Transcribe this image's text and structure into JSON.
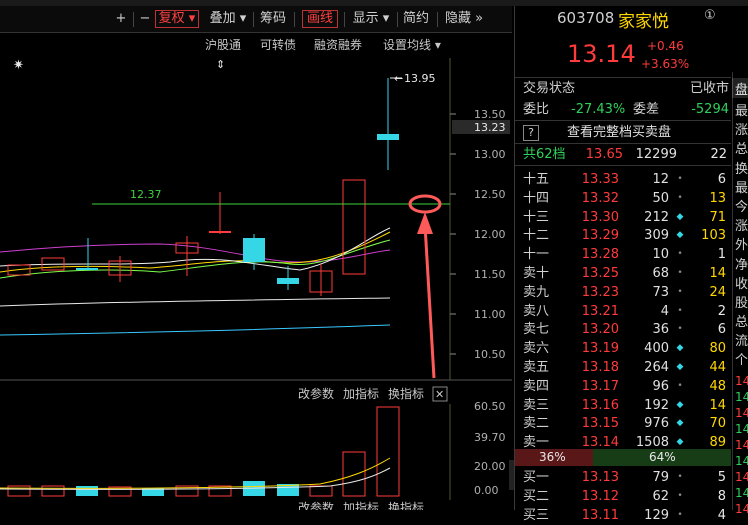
{
  "toolbar": {
    "items": [
      {
        "label": "+",
        "icon": "plus-icon"
      },
      {
        "label": "−",
        "icon": "minus-icon"
      },
      {
        "label": "复权 ▾",
        "selected": true
      },
      {
        "label": "叠加 ▾"
      },
      {
        "label": "筹码"
      },
      {
        "label": "画线",
        "selected": true
      },
      {
        "label": "显示 ▾"
      },
      {
        "label": "简约"
      },
      {
        "label": "隐藏 »"
      }
    ]
  },
  "subbar": {
    "items": [
      "沪股通",
      "可转债",
      "融资融券",
      "设置均线 ▾"
    ]
  },
  "kline": {
    "price_labels": [
      "13.50",
      "13.00",
      "12.50",
      "12.00",
      "11.50",
      "11.00",
      "10.50"
    ],
    "current_price_tag": "13.23",
    "high_label": "13.95",
    "line_label": "12.37",
    "star_glyph": "✷",
    "arrow_glyph": "⇕"
  },
  "indicator": {
    "toolbar": [
      "改参数",
      "加指标",
      "换指标"
    ],
    "close_glyph": "✕",
    "labels": [
      "60.50",
      "39.70",
      "20.00",
      "0.00"
    ],
    "bottom_toolbar": [
      "改参数",
      "加指标",
      "换指标"
    ]
  },
  "quote": {
    "code": "603708",
    "name": "家家悦",
    "circle_num": "①",
    "price": "13.14",
    "change": "+0.46",
    "change_pct": "+3.63%",
    "status_label": "交易状态",
    "status_value": "已收市",
    "webi_label": "委比",
    "webi_value": "-27.43%",
    "weicha_label": "委差",
    "weicha_value": "-5294",
    "full_book_icon": "?",
    "full_book_label": "查看完整档买卖盘",
    "total_label": "共62档",
    "total_price": "13.65",
    "total_vol": "12299",
    "total_n": "22",
    "sell_rows": [
      {
        "label": "十五",
        "price": "13.33",
        "vol": "12",
        "dot": "•",
        "n": "6"
      },
      {
        "label": "十四",
        "price": "13.32",
        "vol": "50",
        "dot": "•",
        "n": "13"
      },
      {
        "label": "十三",
        "price": "13.30",
        "vol": "212",
        "dot": "◆",
        "n": "71"
      },
      {
        "label": "十二",
        "price": "13.29",
        "vol": "309",
        "dot": "◆",
        "n": "103"
      },
      {
        "label": "十一",
        "price": "13.28",
        "vol": "10",
        "dot": "•",
        "n": "1"
      },
      {
        "label": "卖十",
        "price": "13.25",
        "vol": "68",
        "dot": "•",
        "n": "14"
      },
      {
        "label": "卖九",
        "price": "13.23",
        "vol": "73",
        "dot": "•",
        "n": "24"
      },
      {
        "label": "卖八",
        "price": "13.21",
        "vol": "4",
        "dot": "•",
        "n": "2"
      },
      {
        "label": "卖七",
        "price": "13.20",
        "vol": "36",
        "dot": "•",
        "n": "6"
      },
      {
        "label": "卖六",
        "price": "13.19",
        "vol": "400",
        "dot": "◆",
        "n": "80"
      },
      {
        "label": "卖五",
        "price": "13.18",
        "vol": "264",
        "dot": "◆",
        "n": "44"
      },
      {
        "label": "卖四",
        "price": "13.17",
        "vol": "96",
        "dot": "•",
        "n": "48"
      },
      {
        "label": "卖三",
        "price": "13.16",
        "vol": "192",
        "dot": "◆",
        "n": "14"
      },
      {
        "label": "卖二",
        "price": "13.15",
        "vol": "976",
        "dot": "◆",
        "n": "70"
      },
      {
        "label": "卖一",
        "price": "13.14",
        "vol": "1508",
        "dot": "◆",
        "n": "89"
      }
    ],
    "ratio_sell": "36%",
    "ratio_buy": "64%",
    "ratio_sell_frac": 0.36,
    "buy_rows": [
      {
        "label": "买一",
        "price": "13.13",
        "vol": "79",
        "dot": "•",
        "n": "5"
      },
      {
        "label": "买二",
        "price": "13.12",
        "vol": "62",
        "dot": "•",
        "n": "8"
      },
      {
        "label": "买三",
        "price": "13.11",
        "vol": "129",
        "dot": "•",
        "n": "4"
      }
    ]
  },
  "side_tabs": {
    "top": "盘",
    "chars": [
      "最",
      "涨",
      "总",
      "换",
      "最",
      "今",
      "涨",
      "外",
      "净",
      "收",
      "股",
      "总",
      "流"
    ],
    "bottom": "个",
    "numbers": [
      "14",
      "14",
      "14",
      "14",
      "14",
      "14",
      "14",
      "14",
      "14",
      "14"
    ]
  },
  "colors": {
    "up": "#ff3b3b",
    "down": "#2fd05a",
    "cyan": "#35d6e6",
    "yellow": "#ffd800",
    "accent_circle": "#ff5a5a"
  }
}
